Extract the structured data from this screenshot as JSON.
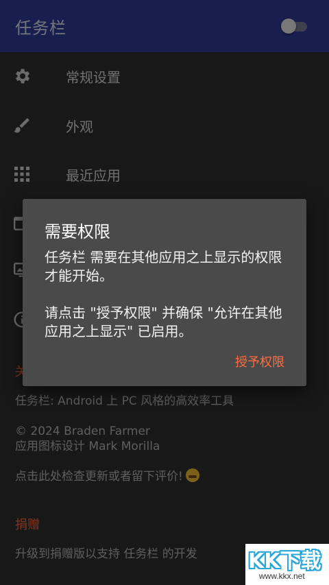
{
  "appbar": {
    "title": "任务栏",
    "toggle_on": false
  },
  "menu": [
    {
      "icon": "gear-icon",
      "label": "常规设置"
    },
    {
      "icon": "brush-icon",
      "label": "外观"
    },
    {
      "icon": "grid-icon",
      "label": "最近应用"
    },
    {
      "icon": "window-icon",
      "label": ""
    },
    {
      "icon": "desktop-icon",
      "label": ""
    },
    {
      "icon": "info-icon",
      "label": ""
    }
  ],
  "about": {
    "section_label": "关",
    "tagline": "任务栏: Android 上 PC 风格的高效率工具",
    "copyright": "© 2024 Braden Farmer",
    "icon_credit": "应用图标设计 Mark Morilla",
    "update_link": "点击此处检查更新或者留下评价!"
  },
  "donate": {
    "section_label": "捐赠",
    "text": "升级到捐赠版以支持 任务栏 的开发"
  },
  "dialog": {
    "title": "需要权限",
    "message": "任务栏 需要在其他应用之上显示的权限才能开始。\n\n请点击 \"授予权限\" 并确保 \"允许在其他应用之上显示\" 已启用。",
    "button": "授予权限"
  },
  "watermark": {
    "logo": "KK下载",
    "url": "www.kkx.net"
  },
  "colors": {
    "appbar": "#303f9f",
    "accent": "#ff6e40",
    "background": "#303030",
    "dialog": "#4a4a4a"
  }
}
